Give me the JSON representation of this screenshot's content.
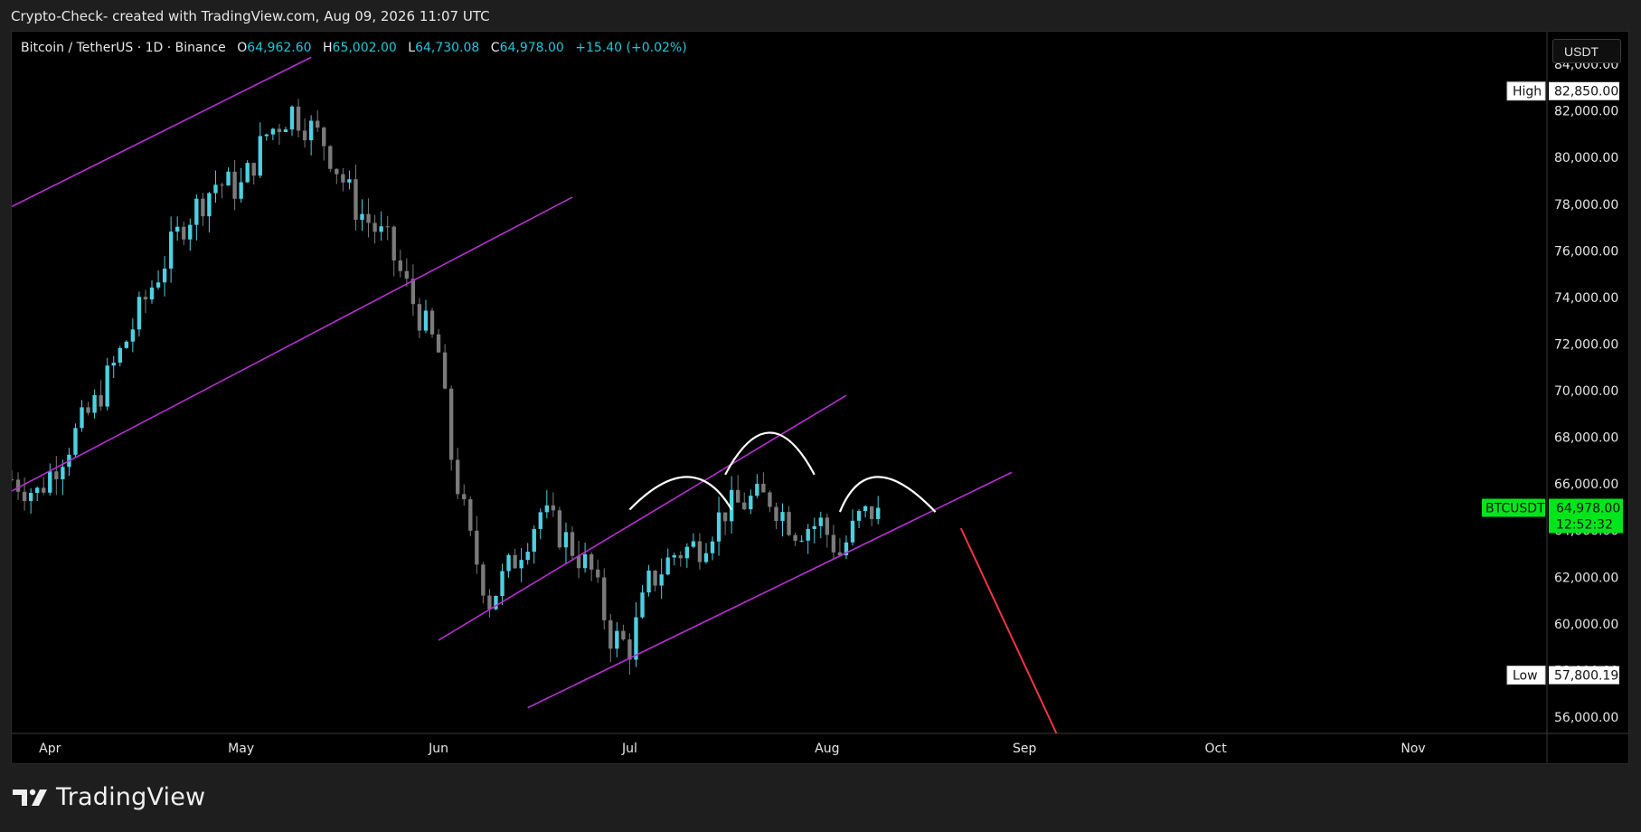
{
  "caption": "Crypto-Check- created with TradingView.com, Aug 09, 2026 11:07 UTC",
  "legend": {
    "symbol": "Bitcoin / TetherUS · 1D · Binance",
    "open_key": "O",
    "open": "64,962.60",
    "high_key": "H",
    "high": "65,002.00",
    "low_key": "L",
    "low": "64,730.08",
    "close_key": "C",
    "close": "64,978.00",
    "change": "+15.40 (+0.02%)"
  },
  "currency": "USDT",
  "brand": "TradingView",
  "colors": {
    "up": "#4dd0e1",
    "down": "#7a7a7a",
    "channel": "#b531d1",
    "arc": "#ffffff",
    "projection": "#f23645",
    "price_tag": "#00e61a"
  },
  "chart_data": {
    "type": "candlestick",
    "title": "Bitcoin / TetherUS · 1D · Binance",
    "x_ticks": [
      "Apr",
      "May",
      "Jun",
      "Jul",
      "Aug",
      "Sep",
      "Oct",
      "Nov"
    ],
    "y_ticks": [
      "56,000.00",
      "58,000.00",
      "60,000.00",
      "62,000.00",
      "64,000.00",
      "66,000.00",
      "68,000.00",
      "70,000.00",
      "72,000.00",
      "74,000.00",
      "76,000.00",
      "78,000.00",
      "80,000.00",
      "82,000.00",
      "84,000.00"
    ],
    "ylim": [
      55300,
      85400
    ],
    "xlim": [
      "2026-03-26",
      "2026-11-22"
    ],
    "grid": false,
    "high_marker": {
      "label": "High",
      "value": "82,850.00"
    },
    "low_marker": {
      "label": "Low",
      "value": "57,800.19"
    },
    "last_price": {
      "label": "BTCUSDT",
      "value": "64,978.00",
      "countdown": "12:52:32"
    },
    "series": [
      {
        "name": "BTCUSDT",
        "close_path": [
          {
            "date": "2026-03-26",
            "close": 66200
          },
          {
            "date": "2026-03-30",
            "close": 65600
          },
          {
            "date": "2026-04-03",
            "close": 67300
          },
          {
            "date": "2026-04-08",
            "close": 69400
          },
          {
            "date": "2026-04-12",
            "close": 71600
          },
          {
            "date": "2026-04-17",
            "close": 74500
          },
          {
            "date": "2026-04-22",
            "close": 77200
          },
          {
            "date": "2026-04-27",
            "close": 78900
          },
          {
            "date": "2026-05-01",
            "close": 78700
          },
          {
            "date": "2026-05-05",
            "close": 81000
          },
          {
            "date": "2026-05-09",
            "close": 82000
          },
          {
            "date": "2026-05-14",
            "close": 80700
          },
          {
            "date": "2026-05-19",
            "close": 77900
          },
          {
            "date": "2026-05-24",
            "close": 76300
          },
          {
            "date": "2026-05-28",
            "close": 73800
          },
          {
            "date": "2026-06-01",
            "close": 71600
          },
          {
            "date": "2026-06-03",
            "close": 67200
          },
          {
            "date": "2026-06-06",
            "close": 63500
          },
          {
            "date": "2026-06-09",
            "close": 61000
          },
          {
            "date": "2026-06-13",
            "close": 62800
          },
          {
            "date": "2026-06-17",
            "close": 64800
          },
          {
            "date": "2026-06-21",
            "close": 63600
          },
          {
            "date": "2026-06-25",
            "close": 62200
          },
          {
            "date": "2026-06-28",
            "close": 59500
          },
          {
            "date": "2026-07-01",
            "close": 59000
          },
          {
            "date": "2026-07-04",
            "close": 61700
          },
          {
            "date": "2026-07-08",
            "close": 63000
          },
          {
            "date": "2026-07-12",
            "close": 63400
          },
          {
            "date": "2026-07-16",
            "close": 64900
          },
          {
            "date": "2026-07-20",
            "close": 65300
          },
          {
            "date": "2026-07-23",
            "close": 65400
          },
          {
            "date": "2026-07-27",
            "close": 64100
          },
          {
            "date": "2026-07-31",
            "close": 64300
          },
          {
            "date": "2026-08-03",
            "close": 63000
          },
          {
            "date": "2026-08-06",
            "close": 64500
          },
          {
            "date": "2026-08-09",
            "close": 64978
          }
        ]
      }
    ],
    "drawings": {
      "channel_lines": [
        {
          "from": {
            "date": "2026-03-26",
            "price": 77900
          },
          "to": {
            "date": "2026-05-12",
            "price": 84300
          }
        },
        {
          "from": {
            "date": "2026-03-26",
            "price": 65700
          },
          "to": {
            "date": "2026-06-22",
            "price": 78300
          }
        },
        {
          "from": {
            "date": "2026-06-01",
            "price": 59300
          },
          "to": {
            "date": "2026-08-04",
            "price": 69800
          }
        },
        {
          "from": {
            "date": "2026-06-15",
            "price": 56400
          },
          "to": {
            "date": "2026-08-30",
            "price": 66500
          }
        }
      ],
      "arcs": [
        {
          "from": {
            "date": "2026-07-01",
            "price": 64900
          },
          "peak": {
            "date": "2026-07-10",
            "price": 66300
          },
          "to": {
            "date": "2026-07-17",
            "price": 64900
          }
        },
        {
          "from": {
            "date": "2026-07-16",
            "price": 66400
          },
          "peak": {
            "date": "2026-07-23",
            "price": 68200
          },
          "to": {
            "date": "2026-07-30",
            "price": 66400
          }
        },
        {
          "from": {
            "date": "2026-08-03",
            "price": 64800
          },
          "peak": {
            "date": "2026-08-09",
            "price": 66300
          },
          "to": {
            "date": "2026-08-18",
            "price": 64800
          }
        }
      ],
      "projection": {
        "from": {
          "date": "2026-08-22",
          "price": 64100
        },
        "to": {
          "date": "2026-09-06",
          "price": 55300
        }
      }
    }
  }
}
